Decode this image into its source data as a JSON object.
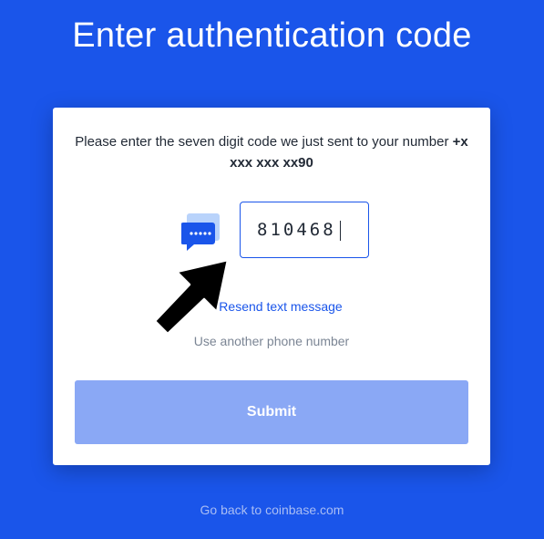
{
  "page": {
    "title": "Enter authentication code"
  },
  "card": {
    "instruction_text": "Please enter the seven digit code we just sent to your number",
    "phone_number": "+x xxx xxx xx90",
    "chat_icon": "sms-chat-icon",
    "code_input_value": "810468",
    "resend_label": "Resend text message",
    "other_number_label": "Use another phone number",
    "submit_label": "Submit"
  },
  "footer": {
    "back_label": "Go back to coinbase.com"
  },
  "overlay": {
    "cursor_icon": "arrow-cursor-icon"
  },
  "colors": {
    "background": "#1a55ea",
    "link": "#1a55ea",
    "submit_disabled": "#8aa8f5",
    "muted": "#7b8594"
  }
}
